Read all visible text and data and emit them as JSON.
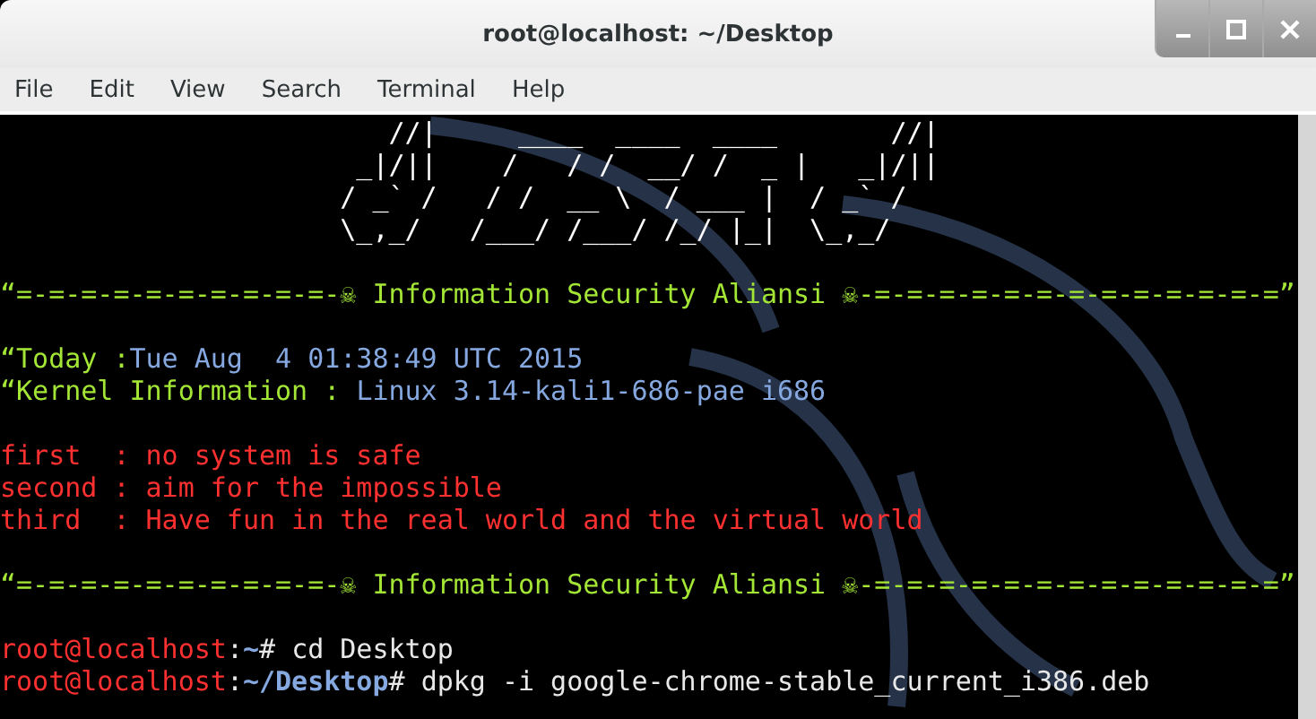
{
  "window": {
    "title": "root@localhost: ~/Desktop"
  },
  "menu": [
    "File",
    "Edit",
    "View",
    "Search",
    "Terminal",
    "Help"
  ],
  "terminal": {
    "blocks": [
      {
        "lines": [
          {
            "kind": "art",
            "text": "                        //|     ____  ____  ____       //|"
          },
          {
            "kind": "art",
            "text": "                      _|/||    /   / /  __/ /  _ |   _|/||"
          },
          {
            "kind": "art",
            "text": "                     / _` /   / /  __ \\  / ___ |  / _` /"
          },
          {
            "kind": "art",
            "text": "                     \\_,_/   /___/ /___/ /_/ |_|  \\_,_/"
          }
        ]
      },
      {
        "lines": [
          {
            "kind": "banner",
            "text": "“=-=-=-=-=-=-=-=-=-=-☠ Information Security Aliansi ☠-=-=-=-=-=-=-=-=-=-=-=-=-=”"
          }
        ]
      },
      {
        "lines": [
          {
            "kind": "info",
            "label": "“Today :",
            "value": "Tue Aug  4 01:38:49 UTC 2015"
          },
          {
            "kind": "info",
            "label": "“Kernel Information : ",
            "value": "Linux 3.14-kali1-686-pae i686"
          }
        ]
      },
      {
        "lines": [
          {
            "kind": "motto",
            "text": "first  : no system is safe"
          },
          {
            "kind": "motto",
            "text": "second : aim for the impossible"
          },
          {
            "kind": "motto",
            "text": "third  : Have fun in the real world and the virtual world"
          }
        ]
      },
      {
        "lines": [
          {
            "kind": "banner",
            "text": "“=-=-=-=-=-=-=-=-=-=-☠ Information Security Aliansi ☠-=-=-=-=-=-=-=-=-=-=-=-=-=”"
          }
        ]
      },
      {
        "lines": [
          {
            "kind": "prompt",
            "user": "root@localhost",
            "sep": ":",
            "path": "~",
            "symbol": "#",
            "command": "cd Desktop"
          },
          {
            "kind": "prompt",
            "user": "root@localhost",
            "sep": ":",
            "path": "~/Desktop",
            "symbol": "#",
            "command": "dpkg -i google-chrome-stable_current_i386.deb"
          }
        ]
      }
    ]
  }
}
